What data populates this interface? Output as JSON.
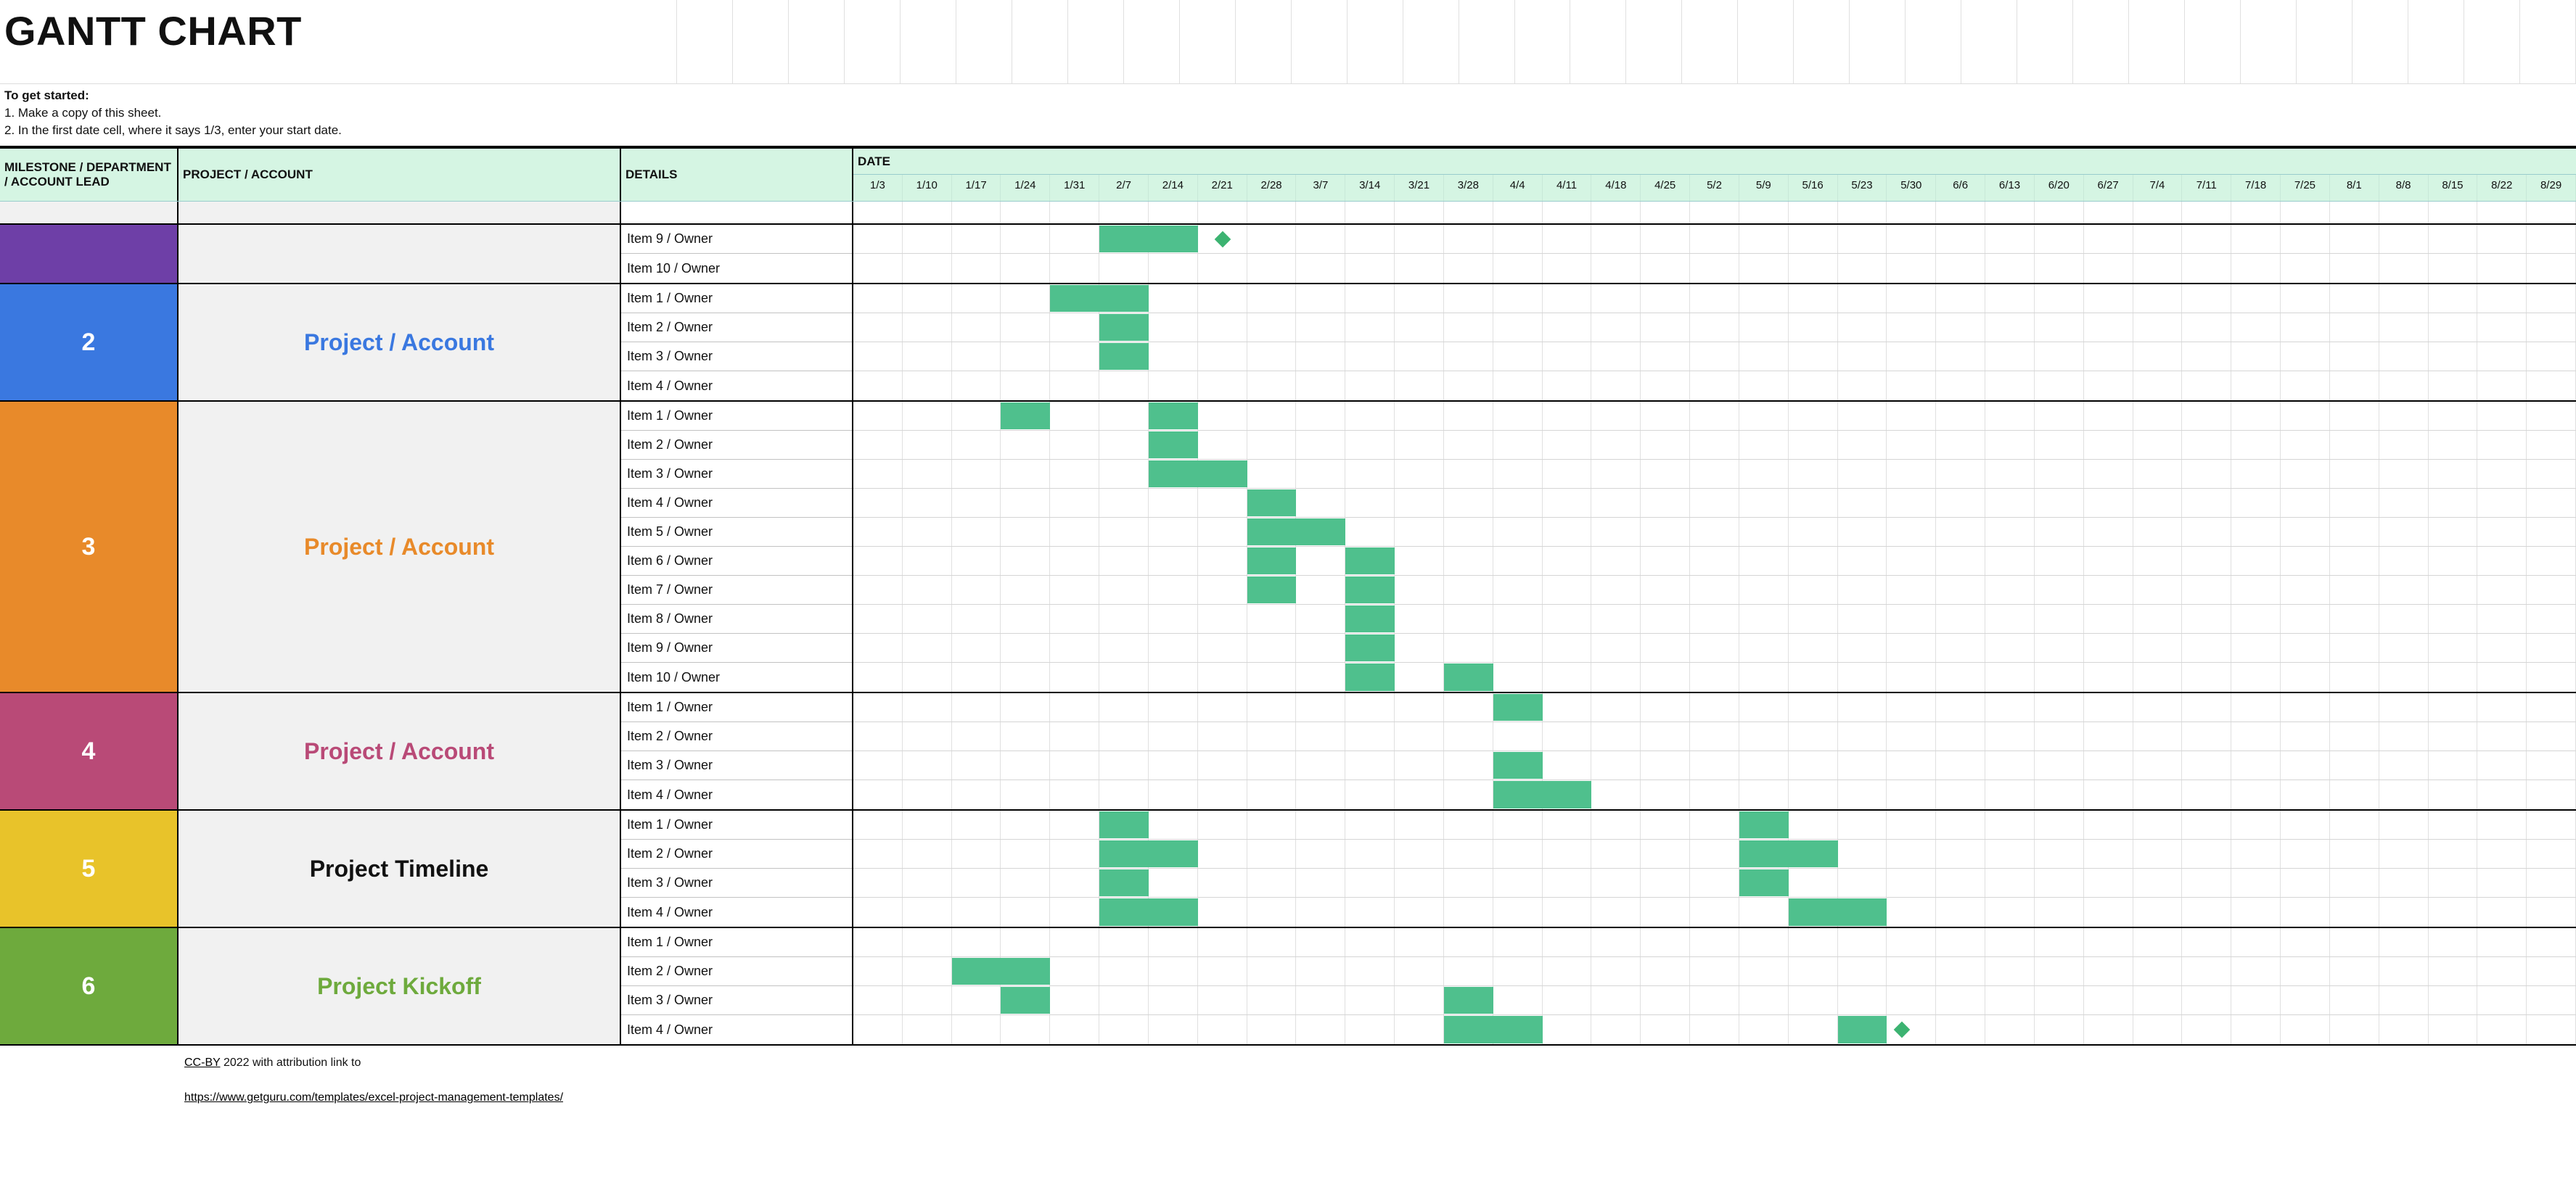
{
  "title": "GANTT CHART",
  "instructions_header": "To get started:",
  "instructions": [
    "1. Make a copy of this sheet.",
    "2. In the first date cell, where it says 1/3, enter your start date."
  ],
  "headers": {
    "milestone": "MILESTONE / DEPARTMENT / ACCOUNT LEAD",
    "project": "PROJECT / ACCOUNT",
    "details": "DETAILS",
    "date": "DATE"
  },
  "dates": [
    "1/3",
    "1/10",
    "1/17",
    "1/24",
    "1/31",
    "2/7",
    "2/14",
    "2/21",
    "2/28",
    "3/7",
    "3/14",
    "3/21",
    "3/28",
    "4/4",
    "4/11",
    "4/18",
    "4/25",
    "5/2",
    "5/9",
    "5/16",
    "5/23",
    "5/30",
    "6/6",
    "6/13",
    "6/20",
    "6/27",
    "7/4",
    "7/11",
    "7/18",
    "7/25",
    "8/1",
    "8/8",
    "8/15",
    "8/22",
    "8/29"
  ],
  "footer": {
    "license_prefix": "CC-BY",
    "license_suffix": " 2022 with attribution link to",
    "url": "https://www.getguru.com/templates/excel-project-management-templates/"
  },
  "groups": [
    {
      "milestone_bg": "#6e3fa7",
      "milestone_label": "",
      "project_label": "",
      "project_color": "#111",
      "items": [
        {
          "name": "Item 9 / Owner",
          "bars": [
            {
              "start": 5,
              "span": 2
            }
          ],
          "milestones": [
            7.5
          ]
        },
        {
          "name": "Item 10 / Owner",
          "bars": [],
          "milestones": []
        }
      ]
    },
    {
      "milestone_bg": "#3a78e0",
      "milestone_label": "2",
      "project_label": "Project / Account",
      "project_color": "#3a78e0",
      "items": [
        {
          "name": "Item 1 / Owner",
          "bars": [
            {
              "start": 4,
              "span": 2
            }
          ],
          "milestones": []
        },
        {
          "name": "Item 2 / Owner",
          "bars": [
            {
              "start": 5,
              "span": 1
            }
          ],
          "milestones": []
        },
        {
          "name": "Item 3 / Owner",
          "bars": [
            {
              "start": 5,
              "span": 1
            }
          ],
          "milestones": []
        },
        {
          "name": "Item 4 / Owner",
          "bars": [],
          "milestones": []
        }
      ]
    },
    {
      "milestone_bg": "#e88a2a",
      "milestone_label": "3",
      "project_label": "Project / Account",
      "project_color": "#e88a2a",
      "items": [
        {
          "name": "Item 1 / Owner",
          "bars": [
            {
              "start": 3,
              "span": 1
            },
            {
              "start": 6,
              "span": 1
            }
          ],
          "milestones": []
        },
        {
          "name": "Item 2 / Owner",
          "bars": [
            {
              "start": 6,
              "span": 1
            }
          ],
          "milestones": []
        },
        {
          "name": "Item 3 / Owner",
          "bars": [
            {
              "start": 6,
              "span": 2
            }
          ],
          "milestones": []
        },
        {
          "name": "Item 4 / Owner",
          "bars": [
            {
              "start": 8,
              "span": 1
            }
          ],
          "milestones": []
        },
        {
          "name": "Item 5 / Owner",
          "bars": [
            {
              "start": 8,
              "span": 2
            }
          ],
          "milestones": []
        },
        {
          "name": "Item 6 / Owner",
          "bars": [
            {
              "start": 8,
              "span": 1
            },
            {
              "start": 10,
              "span": 1
            }
          ],
          "milestones": []
        },
        {
          "name": "Item 7 / Owner",
          "bars": [
            {
              "start": 8,
              "span": 1
            },
            {
              "start": 10,
              "span": 1
            }
          ],
          "milestones": []
        },
        {
          "name": "Item 8 / Owner",
          "bars": [
            {
              "start": 10,
              "span": 1
            }
          ],
          "milestones": []
        },
        {
          "name": "Item 9 / Owner",
          "bars": [
            {
              "start": 10,
              "span": 1
            }
          ],
          "milestones": []
        },
        {
          "name": "Item 10 / Owner",
          "bars": [
            {
              "start": 10,
              "span": 1
            },
            {
              "start": 12,
              "span": 1
            }
          ],
          "milestones": []
        }
      ]
    },
    {
      "milestone_bg": "#b94a77",
      "milestone_label": "4",
      "project_label": "Project / Account",
      "project_color": "#b94a77",
      "items": [
        {
          "name": "Item 1 / Owner",
          "bars": [
            {
              "start": 13,
              "span": 1
            }
          ],
          "milestones": []
        },
        {
          "name": "Item 2 / Owner",
          "bars": [],
          "milestones": []
        },
        {
          "name": "Item 3 / Owner",
          "bars": [
            {
              "start": 13,
              "span": 1
            }
          ],
          "milestones": []
        },
        {
          "name": "Item 4 / Owner",
          "bars": [
            {
              "start": 13,
              "span": 2
            }
          ],
          "milestones": []
        }
      ]
    },
    {
      "milestone_bg": "#e8c32a",
      "milestone_label": "5",
      "project_label": "Project Timeline",
      "project_color": "#111",
      "items": [
        {
          "name": "Item 1 / Owner",
          "bars": [
            {
              "start": 5,
              "span": 1
            },
            {
              "start": 18,
              "span": 1
            }
          ],
          "milestones": []
        },
        {
          "name": "Item 2 / Owner",
          "bars": [
            {
              "start": 5,
              "span": 2
            },
            {
              "start": 18,
              "span": 2
            }
          ],
          "milestones": []
        },
        {
          "name": "Item 3 / Owner",
          "bars": [
            {
              "start": 5,
              "span": 1
            },
            {
              "start": 18,
              "span": 1
            }
          ],
          "milestones": []
        },
        {
          "name": "Item 4 / Owner",
          "bars": [
            {
              "start": 5,
              "span": 2
            },
            {
              "start": 19,
              "span": 2
            }
          ],
          "milestones": []
        }
      ]
    },
    {
      "milestone_bg": "#6eaa3d",
      "milestone_label": "6",
      "project_label": "Project Kickoff",
      "project_color": "#6eaa3d",
      "items": [
        {
          "name": "Item 1 / Owner",
          "bars": [],
          "milestones": []
        },
        {
          "name": "Item 2 / Owner",
          "bars": [
            {
              "start": 2,
              "span": 2
            }
          ],
          "milestones": []
        },
        {
          "name": "Item 3 / Owner",
          "bars": [
            {
              "start": 3,
              "span": 1
            },
            {
              "start": 12,
              "span": 1
            }
          ],
          "milestones": []
        },
        {
          "name": "Item 4 / Owner",
          "bars": [
            {
              "start": 12,
              "span": 2
            },
            {
              "start": 20,
              "span": 1
            }
          ],
          "milestones": [
            21.3
          ]
        }
      ]
    }
  ],
  "chart_data": {
    "type": "bar",
    "title": "GANTT CHART",
    "xlabel": "DATE",
    "ylabel": "DETAILS",
    "categories": [
      "1/3",
      "1/10",
      "1/17",
      "1/24",
      "1/31",
      "2/7",
      "2/14",
      "2/21",
      "2/28",
      "3/7",
      "3/14",
      "3/21",
      "3/28",
      "4/4",
      "4/11",
      "4/18",
      "4/25",
      "5/2",
      "5/9",
      "5/16",
      "5/23",
      "5/30",
      "6/6",
      "6/13",
      "6/20",
      "6/27",
      "7/4",
      "7/11",
      "7/18",
      "7/25",
      "8/1",
      "8/8",
      "8/15",
      "8/22",
      "8/29"
    ],
    "series": [
      {
        "group": "(purple)",
        "name": "Item 9 / Owner",
        "bars": [
          [
            "2/7",
            "2/21"
          ]
        ],
        "milestones": [
          "2/23"
        ]
      },
      {
        "group": "(purple)",
        "name": "Item 10 / Owner",
        "bars": [],
        "milestones": []
      },
      {
        "group": "2",
        "name": "Item 1 / Owner",
        "bars": [
          [
            "1/31",
            "2/14"
          ]
        ],
        "milestones": []
      },
      {
        "group": "2",
        "name": "Item 2 / Owner",
        "bars": [
          [
            "2/7",
            "2/14"
          ]
        ],
        "milestones": []
      },
      {
        "group": "2",
        "name": "Item 3 / Owner",
        "bars": [
          [
            "2/7",
            "2/14"
          ]
        ],
        "milestones": []
      },
      {
        "group": "2",
        "name": "Item 4 / Owner",
        "bars": [],
        "milestones": []
      },
      {
        "group": "3",
        "name": "Item 1 / Owner",
        "bars": [
          [
            "1/24",
            "1/31"
          ],
          [
            "2/14",
            "2/21"
          ]
        ],
        "milestones": []
      },
      {
        "group": "3",
        "name": "Item 2 / Owner",
        "bars": [
          [
            "2/14",
            "2/21"
          ]
        ],
        "milestones": []
      },
      {
        "group": "3",
        "name": "Item 3 / Owner",
        "bars": [
          [
            "2/14",
            "2/28"
          ]
        ],
        "milestones": []
      },
      {
        "group": "3",
        "name": "Item 4 / Owner",
        "bars": [
          [
            "2/28",
            "3/7"
          ]
        ],
        "milestones": []
      },
      {
        "group": "3",
        "name": "Item 5 / Owner",
        "bars": [
          [
            "2/28",
            "3/14"
          ]
        ],
        "milestones": []
      },
      {
        "group": "3",
        "name": "Item 6 / Owner",
        "bars": [
          [
            "2/28",
            "3/7"
          ],
          [
            "3/14",
            "3/21"
          ]
        ],
        "milestones": []
      },
      {
        "group": "3",
        "name": "Item 7 / Owner",
        "bars": [
          [
            "2/28",
            "3/7"
          ],
          [
            "3/14",
            "3/21"
          ]
        ],
        "milestones": []
      },
      {
        "group": "3",
        "name": "Item 8 / Owner",
        "bars": [
          [
            "3/14",
            "3/21"
          ]
        ],
        "milestones": []
      },
      {
        "group": "3",
        "name": "Item 9 / Owner",
        "bars": [
          [
            "3/14",
            "3/21"
          ]
        ],
        "milestones": []
      },
      {
        "group": "3",
        "name": "Item 10 / Owner",
        "bars": [
          [
            "3/14",
            "3/21"
          ],
          [
            "3/28",
            "4/4"
          ]
        ],
        "milestones": []
      },
      {
        "group": "4",
        "name": "Item 1 / Owner",
        "bars": [
          [
            "4/4",
            "4/11"
          ]
        ],
        "milestones": []
      },
      {
        "group": "4",
        "name": "Item 2 / Owner",
        "bars": [],
        "milestones": []
      },
      {
        "group": "4",
        "name": "Item 3 / Owner",
        "bars": [
          [
            "4/4",
            "4/11"
          ]
        ],
        "milestones": []
      },
      {
        "group": "4",
        "name": "Item 4 / Owner",
        "bars": [
          [
            "4/4",
            "4/18"
          ]
        ],
        "milestones": []
      },
      {
        "group": "5",
        "name": "Item 1 / Owner",
        "bars": [
          [
            "2/7",
            "2/14"
          ],
          [
            "5/9",
            "5/16"
          ]
        ],
        "milestones": []
      },
      {
        "group": "5",
        "name": "Item 2 / Owner",
        "bars": [
          [
            "2/7",
            "2/21"
          ],
          [
            "5/9",
            "5/23"
          ]
        ],
        "milestones": []
      },
      {
        "group": "5",
        "name": "Item 3 / Owner",
        "bars": [
          [
            "2/7",
            "2/14"
          ],
          [
            "5/9",
            "5/16"
          ]
        ],
        "milestones": []
      },
      {
        "group": "5",
        "name": "Item 4 / Owner",
        "bars": [
          [
            "2/7",
            "2/21"
          ],
          [
            "5/16",
            "5/30"
          ]
        ],
        "milestones": []
      },
      {
        "group": "6",
        "name": "Item 1 / Owner",
        "bars": [],
        "milestones": []
      },
      {
        "group": "6",
        "name": "Item 2 / Owner",
        "bars": [
          [
            "1/17",
            "1/31"
          ]
        ],
        "milestones": []
      },
      {
        "group": "6",
        "name": "Item 3 / Owner",
        "bars": [
          [
            "1/24",
            "1/31"
          ],
          [
            "3/28",
            "4/4"
          ]
        ],
        "milestones": []
      },
      {
        "group": "6",
        "name": "Item 4 / Owner",
        "bars": [
          [
            "3/28",
            "4/11"
          ],
          [
            "5/23",
            "5/30"
          ]
        ],
        "milestones": [
          "5/31"
        ]
      }
    ],
    "xlim": [
      "1/3",
      "8/29"
    ]
  }
}
